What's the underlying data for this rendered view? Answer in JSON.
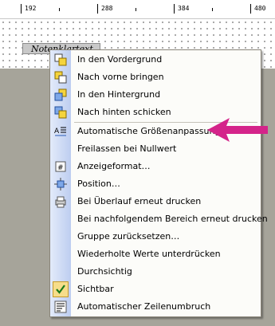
{
  "ruler": {
    "labels": [
      "192",
      "288",
      "384",
      "480"
    ]
  },
  "field": {
    "label": "Notenklartext"
  },
  "menu": {
    "items": [
      {
        "label": "In  den  Vordergrund",
        "icon": "bring-to-front-icon"
      },
      {
        "label": "Nach vorne bringen",
        "icon": "bring-forward-icon"
      },
      {
        "label": "In den Hintergrund",
        "icon": "send-to-back-icon"
      },
      {
        "label": "Nach hinten schicken",
        "icon": "send-backward-icon"
      },
      {
        "label": "Automatische Größenanpassung",
        "icon": "auto-size-icon"
      },
      {
        "label": "Freilassen bei Nullwert",
        "icon": ""
      },
      {
        "label": "Anzeigeformat…",
        "icon": "format-icon"
      },
      {
        "label": "Position…",
        "icon": "position-icon"
      },
      {
        "label": "Bei Überlauf erneut drucken",
        "icon": "overflow-print-icon"
      },
      {
        "label": "Bei nachfolgendem Bereich erneut drucken",
        "icon": ""
      },
      {
        "label": "Gruppe zurücksetzen…",
        "icon": ""
      },
      {
        "label": "Wiederholte Werte unterdrücken",
        "icon": ""
      },
      {
        "label": "Durchsichtig",
        "icon": ""
      },
      {
        "label": "Sichtbar",
        "icon": "checkmark-icon",
        "checked": true
      },
      {
        "label": "Automatischer Zeilenumbruch",
        "icon": "word-wrap-icon"
      }
    ]
  },
  "annotation": {
    "color": "#d4248a",
    "icon": "pointer-arrow-icon"
  },
  "colors": {
    "menu_gutter": "#c6d3f2",
    "canvas_gray": "#a6a49a"
  }
}
